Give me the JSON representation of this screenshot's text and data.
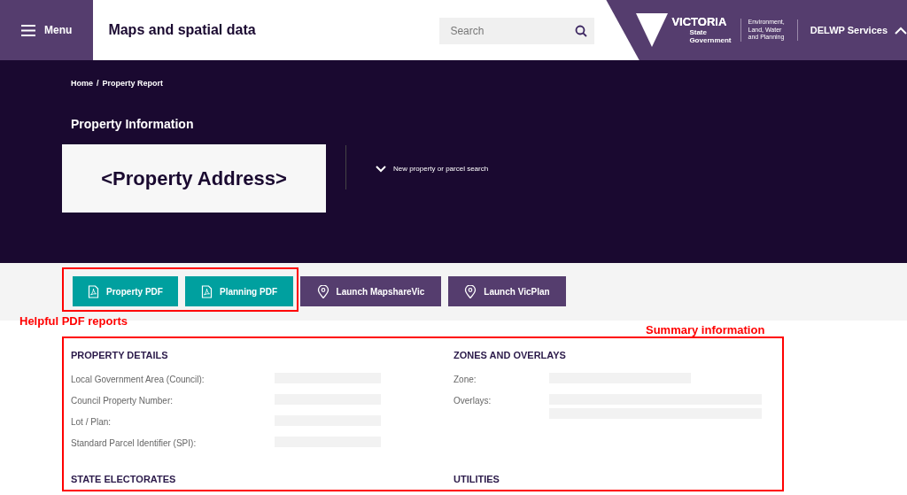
{
  "header": {
    "menu_label": "Menu",
    "site_title": "Maps and spatial data",
    "search": {
      "placeholder": "Search"
    },
    "logo": {
      "wordmark": "VICTORIA",
      "subtitle": "State\nGovernment",
      "department": "Environment,\nLand, Water\nand Planning"
    },
    "services": {
      "label": "DELWP Services",
      "expanded": true
    }
  },
  "breadcrumb": {
    "items": [
      "Home",
      "Property Report"
    ],
    "separator": "/"
  },
  "page_title": "Property Information",
  "address": "<Property Address>",
  "new_search": {
    "label": "New property or parcel search",
    "expanded": false
  },
  "actions": [
    {
      "label": "Property PDF",
      "kind": "pdf"
    },
    {
      "label": "Planning PDF",
      "kind": "pdf"
    },
    {
      "label": "Launch MapshareVic",
      "kind": "map"
    },
    {
      "label": "Launch VicPlan",
      "kind": "map"
    }
  ],
  "sections": [
    {
      "title": "PROPERTY DETAILS",
      "fields": [
        {
          "label": "Local Government Area (Council):",
          "kind": "single"
        },
        {
          "label": "Council Property Number:",
          "kind": "single"
        },
        {
          "label": "Lot / Plan:",
          "kind": "single"
        },
        {
          "label": "Standard Parcel Identifier (SPI):",
          "kind": "single"
        }
      ]
    },
    {
      "title": "ZONES AND OVERLAYS",
      "fields": [
        {
          "label": "Zone:",
          "kind": "wide"
        },
        {
          "label": "Overlays:",
          "kind": "double"
        }
      ]
    },
    {
      "title": "STATE ELECTORATES"
    },
    {
      "title": "UTILITIES"
    }
  ],
  "annotations": [
    {
      "label": "Helpful PDF reports"
    },
    {
      "label": "Summary information"
    }
  ]
}
